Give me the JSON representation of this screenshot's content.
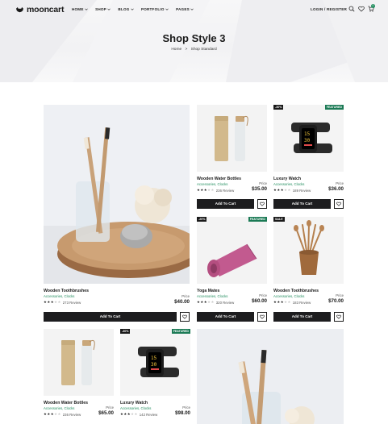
{
  "brand": {
    "name": "mooncart"
  },
  "nav": {
    "items": [
      {
        "label": "HOME"
      },
      {
        "label": "SHOP"
      },
      {
        "label": "BLOG"
      },
      {
        "label": "PORTFOLIO"
      },
      {
        "label": "PAGES"
      }
    ],
    "login_label": "LOGIN / REGISTER",
    "cart_count": "0"
  },
  "page": {
    "title": "Shop Style 3",
    "breadcrumb": [
      "Home",
      "Shop Standard"
    ],
    "breadcrumb_separator": ">"
  },
  "colors": {
    "accent": "#1b8a5a",
    "button": "#1d1d1f"
  },
  "products": [
    {
      "name": "Wooden Toothbrushes",
      "category": "Accessories, Clocks",
      "rating": 3,
      "reviews": "273 Review",
      "price_label": "Price",
      "price": "$40.00",
      "cta": "Add To Cart",
      "badge": "",
      "tag": ""
    },
    {
      "name": "Wooden Water Bottles",
      "category": "Accessories, Clocks",
      "rating": 3,
      "reviews": "236 Review",
      "price_label": "Price",
      "price": "$35.00",
      "cta": "Add To Cart",
      "badge": "",
      "tag": ""
    },
    {
      "name": "Luxury Watch",
      "category": "Accessories, Clocks",
      "rating": 3,
      "reviews": "189 Review",
      "price_label": "Price",
      "price": "$36.00",
      "cta": "Add To Cart",
      "badge": "-30%",
      "tag": "FEATURED"
    },
    {
      "name": "Yoga Mates",
      "category": "Accessories, Clocks",
      "rating": 3,
      "reviews": "320 Review",
      "price_label": "Price",
      "price": "$60.00",
      "cta": "Add To Cart",
      "badge": "-20%",
      "tag": "FEATURED"
    },
    {
      "name": "Wooden Toothbrushes",
      "category": "Accessories, Clocks",
      "rating": 3,
      "reviews": "183 Review",
      "price_label": "Price",
      "price": "$70.00",
      "cta": "Add To Cart",
      "badge": "SALE",
      "tag": ""
    },
    {
      "name": "Wooden Water Bottles",
      "category": "Accessories, Clocks",
      "rating": 3,
      "reviews": "236 Review",
      "price_label": "Price",
      "price": "$65.00",
      "cta": "",
      "badge": "",
      "tag": ""
    },
    {
      "name": "Luxury Watch",
      "category": "Accessories, Clocks",
      "rating": 3,
      "reviews": "142 Review",
      "price_label": "Price",
      "price": "$98.00",
      "cta": "",
      "badge": "-30%",
      "tag": "FEATURED"
    }
  ]
}
